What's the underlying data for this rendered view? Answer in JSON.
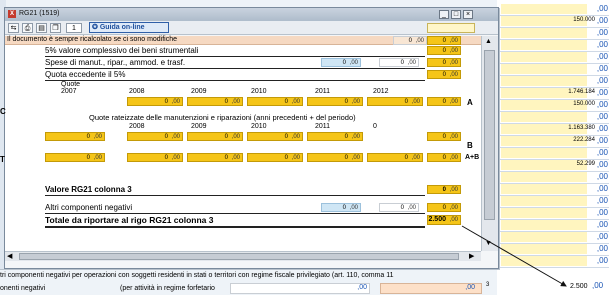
{
  "window": {
    "title": "RG21 (1519)",
    "page_number": "1",
    "guide_label": "Guida on-line",
    "header_row_text": "Il documento è sempre ricalcolato se ci sono modifiche",
    "header_value": "0",
    "header_dec": ",00"
  },
  "form": {
    "label_5pct": "5% valore complessivo dei beni strumentali",
    "label_spese": "Spese di manut., ripar., ammod. e trasf.",
    "label_quota_5pct": "Quota eccedente il 5%",
    "label_quote": "Quote",
    "years_a": [
      "2007",
      "2008",
      "2009",
      "2010",
      "2011",
      "2012"
    ],
    "marker_a": "A",
    "label_rateizzate": "Quote rateizzate delle manutenzioni e riparazioni (anni precedenti + del periodo)",
    "years_b": [
      "2008",
      "2009",
      "2010",
      "2011",
      "0"
    ],
    "marker_b": "B",
    "marker_ab": "A+B",
    "label_valore": "Valore RG21 colonna 3",
    "label_altri": "Altri componenti negativi",
    "label_totale": "Totale da riportare al rigo  RG21 colonna 3",
    "zero": "0",
    "dec": ",00",
    "valore_val": "0",
    "totale_val": "2.500"
  },
  "background_values": [
    {
      "value": "",
      "dec": ",00"
    },
    {
      "value": "150.000",
      "dec": ",00"
    },
    {
      "value": "",
      "dec": ",00"
    },
    {
      "value": "",
      "dec": ",00"
    },
    {
      "value": "",
      "dec": ",00"
    },
    {
      "value": "",
      "dec": ",00"
    },
    {
      "value": "",
      "dec": ",00"
    },
    {
      "value": "1.746.184",
      "dec": ",00"
    },
    {
      "value": "150.000",
      "dec": ",00"
    },
    {
      "value": "",
      "dec": ",00"
    },
    {
      "value": "1.163.380",
      "dec": ",00"
    },
    {
      "value": "222.284",
      "dec": ",00"
    },
    {
      "value": "",
      "dec": ",00"
    },
    {
      "value": "52.299",
      "dec": ",00"
    },
    {
      "value": "",
      "dec": ",00"
    },
    {
      "value": "",
      "dec": ",00"
    },
    {
      "value": "",
      "dec": ",00"
    },
    {
      "value": "",
      "dec": ",00"
    },
    {
      "value": "",
      "dec": ",00"
    },
    {
      "value": "",
      "dec": ",00"
    },
    {
      "value": "",
      "dec": ",00"
    },
    {
      "value": "",
      "dec": ",00"
    }
  ],
  "left_letters": [
    "C",
    "T",
    "C",
    "T"
  ],
  "footer": {
    "line1": "tri componenti negativi per operazioni con soggetti residenti in stati o territori con regime fiscale privilegiato (art. 110, comma 11",
    "line2_label": "onenti negativi",
    "line2_mid": "(per attività in regime forfetario",
    "line2_v1": ",00",
    "line2_v2": ",00",
    "line2_sup": "3",
    "line2_final": "2.500",
    "line2_final_dec": ",00"
  }
}
